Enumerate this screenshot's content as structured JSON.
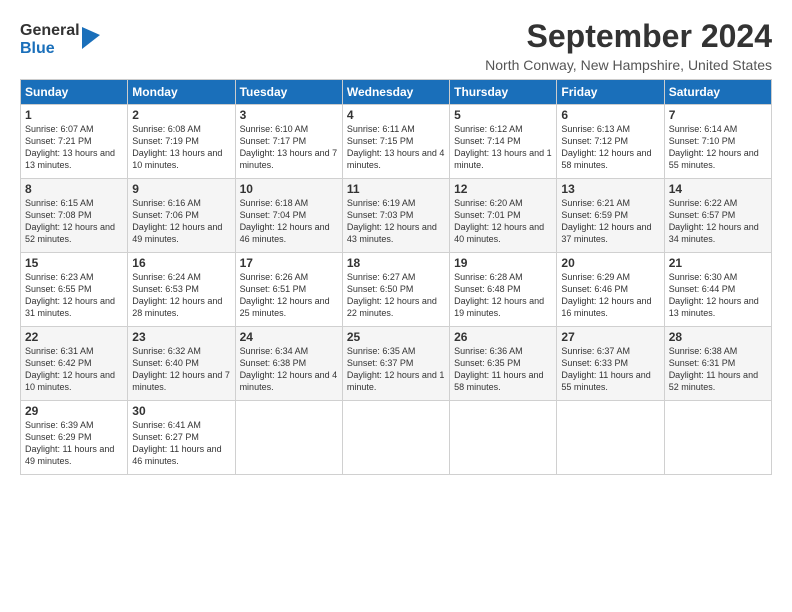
{
  "logo": {
    "general": "General",
    "blue": "Blue"
  },
  "title": "September 2024",
  "location": "North Conway, New Hampshire, United States",
  "days_header": [
    "Sunday",
    "Monday",
    "Tuesday",
    "Wednesday",
    "Thursday",
    "Friday",
    "Saturday"
  ],
  "weeks": [
    [
      {
        "day": "1",
        "sunrise": "Sunrise: 6:07 AM",
        "sunset": "Sunset: 7:21 PM",
        "daylight": "Daylight: 13 hours and 13 minutes."
      },
      {
        "day": "2",
        "sunrise": "Sunrise: 6:08 AM",
        "sunset": "Sunset: 7:19 PM",
        "daylight": "Daylight: 13 hours and 10 minutes."
      },
      {
        "day": "3",
        "sunrise": "Sunrise: 6:10 AM",
        "sunset": "Sunset: 7:17 PM",
        "daylight": "Daylight: 13 hours and 7 minutes."
      },
      {
        "day": "4",
        "sunrise": "Sunrise: 6:11 AM",
        "sunset": "Sunset: 7:15 PM",
        "daylight": "Daylight: 13 hours and 4 minutes."
      },
      {
        "day": "5",
        "sunrise": "Sunrise: 6:12 AM",
        "sunset": "Sunset: 7:14 PM",
        "daylight": "Daylight: 13 hours and 1 minute."
      },
      {
        "day": "6",
        "sunrise": "Sunrise: 6:13 AM",
        "sunset": "Sunset: 7:12 PM",
        "daylight": "Daylight: 12 hours and 58 minutes."
      },
      {
        "day": "7",
        "sunrise": "Sunrise: 6:14 AM",
        "sunset": "Sunset: 7:10 PM",
        "daylight": "Daylight: 12 hours and 55 minutes."
      }
    ],
    [
      {
        "day": "8",
        "sunrise": "Sunrise: 6:15 AM",
        "sunset": "Sunset: 7:08 PM",
        "daylight": "Daylight: 12 hours and 52 minutes."
      },
      {
        "day": "9",
        "sunrise": "Sunrise: 6:16 AM",
        "sunset": "Sunset: 7:06 PM",
        "daylight": "Daylight: 12 hours and 49 minutes."
      },
      {
        "day": "10",
        "sunrise": "Sunrise: 6:18 AM",
        "sunset": "Sunset: 7:04 PM",
        "daylight": "Daylight: 12 hours and 46 minutes."
      },
      {
        "day": "11",
        "sunrise": "Sunrise: 6:19 AM",
        "sunset": "Sunset: 7:03 PM",
        "daylight": "Daylight: 12 hours and 43 minutes."
      },
      {
        "day": "12",
        "sunrise": "Sunrise: 6:20 AM",
        "sunset": "Sunset: 7:01 PM",
        "daylight": "Daylight: 12 hours and 40 minutes."
      },
      {
        "day": "13",
        "sunrise": "Sunrise: 6:21 AM",
        "sunset": "Sunset: 6:59 PM",
        "daylight": "Daylight: 12 hours and 37 minutes."
      },
      {
        "day": "14",
        "sunrise": "Sunrise: 6:22 AM",
        "sunset": "Sunset: 6:57 PM",
        "daylight": "Daylight: 12 hours and 34 minutes."
      }
    ],
    [
      {
        "day": "15",
        "sunrise": "Sunrise: 6:23 AM",
        "sunset": "Sunset: 6:55 PM",
        "daylight": "Daylight: 12 hours and 31 minutes."
      },
      {
        "day": "16",
        "sunrise": "Sunrise: 6:24 AM",
        "sunset": "Sunset: 6:53 PM",
        "daylight": "Daylight: 12 hours and 28 minutes."
      },
      {
        "day": "17",
        "sunrise": "Sunrise: 6:26 AM",
        "sunset": "Sunset: 6:51 PM",
        "daylight": "Daylight: 12 hours and 25 minutes."
      },
      {
        "day": "18",
        "sunrise": "Sunrise: 6:27 AM",
        "sunset": "Sunset: 6:50 PM",
        "daylight": "Daylight: 12 hours and 22 minutes."
      },
      {
        "day": "19",
        "sunrise": "Sunrise: 6:28 AM",
        "sunset": "Sunset: 6:48 PM",
        "daylight": "Daylight: 12 hours and 19 minutes."
      },
      {
        "day": "20",
        "sunrise": "Sunrise: 6:29 AM",
        "sunset": "Sunset: 6:46 PM",
        "daylight": "Daylight: 12 hours and 16 minutes."
      },
      {
        "day": "21",
        "sunrise": "Sunrise: 6:30 AM",
        "sunset": "Sunset: 6:44 PM",
        "daylight": "Daylight: 12 hours and 13 minutes."
      }
    ],
    [
      {
        "day": "22",
        "sunrise": "Sunrise: 6:31 AM",
        "sunset": "Sunset: 6:42 PM",
        "daylight": "Daylight: 12 hours and 10 minutes."
      },
      {
        "day": "23",
        "sunrise": "Sunrise: 6:32 AM",
        "sunset": "Sunset: 6:40 PM",
        "daylight": "Daylight: 12 hours and 7 minutes."
      },
      {
        "day": "24",
        "sunrise": "Sunrise: 6:34 AM",
        "sunset": "Sunset: 6:38 PM",
        "daylight": "Daylight: 12 hours and 4 minutes."
      },
      {
        "day": "25",
        "sunrise": "Sunrise: 6:35 AM",
        "sunset": "Sunset: 6:37 PM",
        "daylight": "Daylight: 12 hours and 1 minute."
      },
      {
        "day": "26",
        "sunrise": "Sunrise: 6:36 AM",
        "sunset": "Sunset: 6:35 PM",
        "daylight": "Daylight: 11 hours and 58 minutes."
      },
      {
        "day": "27",
        "sunrise": "Sunrise: 6:37 AM",
        "sunset": "Sunset: 6:33 PM",
        "daylight": "Daylight: 11 hours and 55 minutes."
      },
      {
        "day": "28",
        "sunrise": "Sunrise: 6:38 AM",
        "sunset": "Sunset: 6:31 PM",
        "daylight": "Daylight: 11 hours and 52 minutes."
      }
    ],
    [
      {
        "day": "29",
        "sunrise": "Sunrise: 6:39 AM",
        "sunset": "Sunset: 6:29 PM",
        "daylight": "Daylight: 11 hours and 49 minutes."
      },
      {
        "day": "30",
        "sunrise": "Sunrise: 6:41 AM",
        "sunset": "Sunset: 6:27 PM",
        "daylight": "Daylight: 11 hours and 46 minutes."
      },
      null,
      null,
      null,
      null,
      null
    ]
  ]
}
